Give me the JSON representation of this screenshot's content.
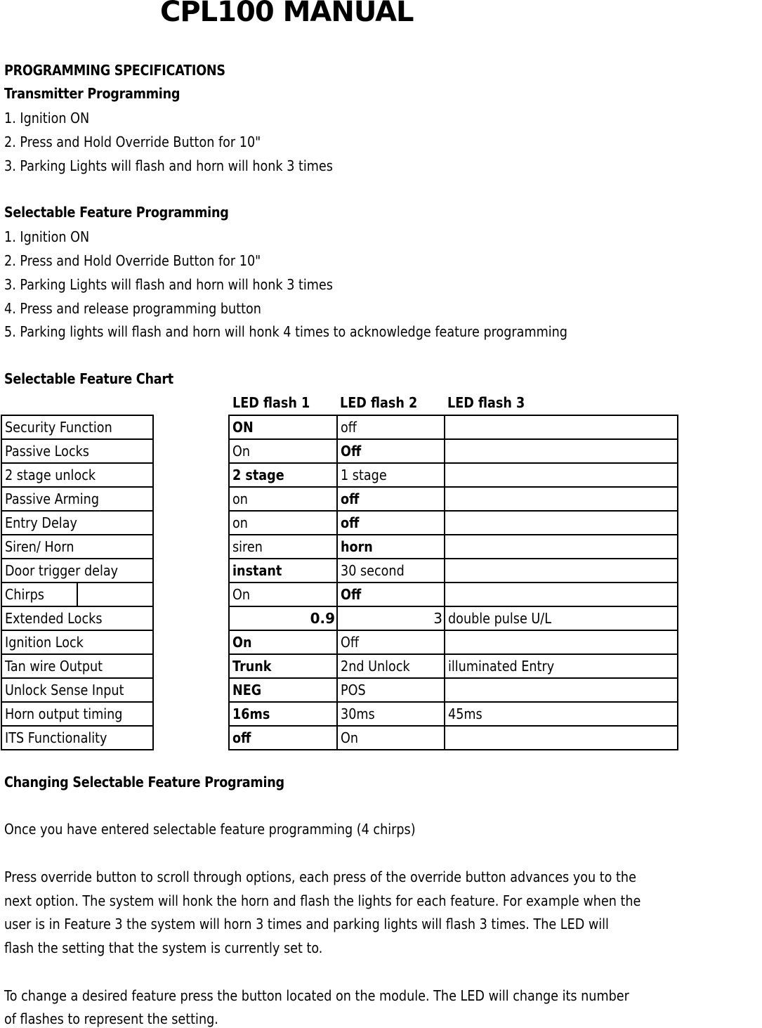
{
  "title": "CPL100 MANUAL",
  "section_heading": "PROGRAMMING SPECIFICATIONS",
  "transmitter": {
    "heading": "Transmitter Programming",
    "steps": [
      "1. Ignition ON",
      "2. Press and Hold Override Button for 10\"",
      "3. Parking Lights will flash and horn will honk 3 times"
    ]
  },
  "selectable": {
    "heading": "Selectable Feature Programming",
    "steps": [
      "1. Ignition ON",
      "2. Press and Hold Override Button for 10\"",
      "3. Parking Lights will flash and horn will honk 3 times",
      "4. Press and release programming button",
      "5. Parking lights will flash and horn will honk 4 times to acknowledge feature programming"
    ]
  },
  "chart": {
    "heading": "Selectable Feature Chart",
    "columns": [
      "LED flash 1",
      "LED flash 2",
      "LED flash 3"
    ],
    "rows": [
      {
        "feature": "Security Function",
        "f1": "ON",
        "f2": "off",
        "f3": "",
        "bold": 1
      },
      {
        "feature": "Passive Locks",
        "f1": "On",
        "f2": "Off",
        "f3": "",
        "bold": 2
      },
      {
        "feature": "2 stage unlock",
        "f1": "2 stage",
        "f2": "1 stage",
        "f3": "",
        "bold": 1
      },
      {
        "feature": "Passive Arming",
        "f1": "on",
        "f2": "off",
        "f3": "",
        "bold": 2
      },
      {
        "feature": "Entry Delay",
        "f1": "on",
        "f2": "off",
        "f3": "",
        "bold": 2
      },
      {
        "feature": "Siren/ Horn",
        "f1": "siren",
        "f2": "horn",
        "f3": "",
        "bold": 2
      },
      {
        "feature": "Door trigger delay",
        "f1": "instant",
        "f2": "30 second",
        "f3": "",
        "bold": 1
      },
      {
        "feature": "Chirps",
        "f1": "On",
        "f2": "Off",
        "f3": "",
        "bold": 2
      },
      {
        "feature": "Extended Locks",
        "f1": "0.9",
        "f2": "3",
        "f3": "double pulse U/L",
        "bold": 1
      },
      {
        "feature": "Ignition Lock",
        "f1": "On",
        "f2": "Off",
        "f3": "",
        "bold": 1
      },
      {
        "feature": "Tan wire Output",
        "f1": "Trunk",
        "f2": "2nd Unlock",
        "f3": "illuminated Entry",
        "bold": 1
      },
      {
        "feature": "Unlock Sense Input",
        "f1": "NEG",
        "f2": "POS",
        "f3": "",
        "bold": 1
      },
      {
        "feature": "Horn output timing",
        "f1": "16ms",
        "f2": "30ms",
        "f3": "45ms",
        "bold": 1
      },
      {
        "feature": "ITS Functionality",
        "f1": "off",
        "f2": "On",
        "f3": "",
        "bold": 1
      }
    ]
  },
  "changing": {
    "heading": "Changing Selectable Feature Programing",
    "para1": "Once you have entered selectable feature programming (4 chirps)",
    "para2_lines": [
      "Press override button to scroll through options, each press of the override button advances you to the",
      "next option. The system will honk the horn and flash the lights for each feature. For example when the",
      "user is in Feature 3 the system will horn 3 times and parking lights will flash 3 times. The LED will",
      "flash the setting that the system is currently set to."
    ],
    "para3_lines": [
      "To change a desired feature press the button located on the module. The LED will change its number",
      "of flashes to represent the setting."
    ]
  }
}
